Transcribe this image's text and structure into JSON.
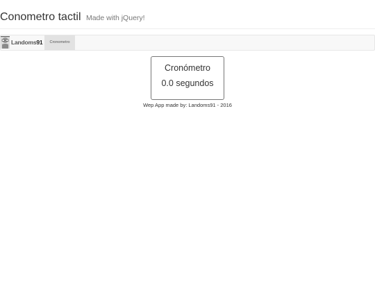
{
  "header": {
    "title": "Conometro tactil",
    "subtitle": "Made with jQuery!"
  },
  "navbar": {
    "brand_name": "Landoms",
    "brand_number": "91",
    "tabs": [
      {
        "label": "Cronometro",
        "active": true
      }
    ]
  },
  "stopwatch": {
    "title": "Cronómetro",
    "value": "0.0 segundos"
  },
  "footer": {
    "text": "Wep App made by: Landoms91 - 2016"
  },
  "colors": {
    "navbar_bg": "#f8f8f8",
    "active_tab_bg": "#e2e2e2",
    "box_border": "#777777"
  }
}
